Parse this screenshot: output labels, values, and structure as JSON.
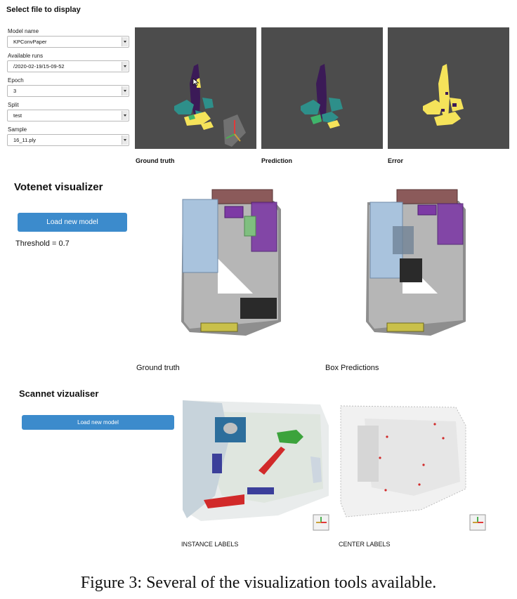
{
  "kpconv": {
    "title": "Select file to display",
    "fields": [
      {
        "label": "Model name",
        "value": "KPConvPaper"
      },
      {
        "label": "Available runs",
        "value": "/2020-02-19/15-09-52"
      },
      {
        "label": "Epoch",
        "value": "3"
      },
      {
        "label": "Split",
        "value": "test"
      },
      {
        "label": "Sample",
        "value": "16_11.ply"
      }
    ],
    "views": [
      "Ground truth",
      "Prediction",
      "Error"
    ]
  },
  "votenet": {
    "title": "Votenet visualizer",
    "load_button": "Load new model",
    "threshold": "Threshold = 0.7",
    "views": [
      "Ground truth",
      "Box Predictions"
    ]
  },
  "scannet": {
    "title": "Scannet vizualiser",
    "load_button": "Load new model",
    "views": [
      "INSTANCE LABELS",
      "CENTER LABELS"
    ]
  },
  "caption": "Figure 3: Several of the visualization tools available.",
  "icons": [
    "cursor-icon",
    "axes-gizmo-icon",
    "chevron-down-icon"
  ],
  "colors": {
    "viewer_bg": "#4c4c4c",
    "button_blue": "#3c8bcc",
    "class_yellow": "#f5e35a",
    "class_purple": "#3b1a57",
    "class_teal": "#2e8f8a",
    "class_green": "#3fb56b"
  }
}
